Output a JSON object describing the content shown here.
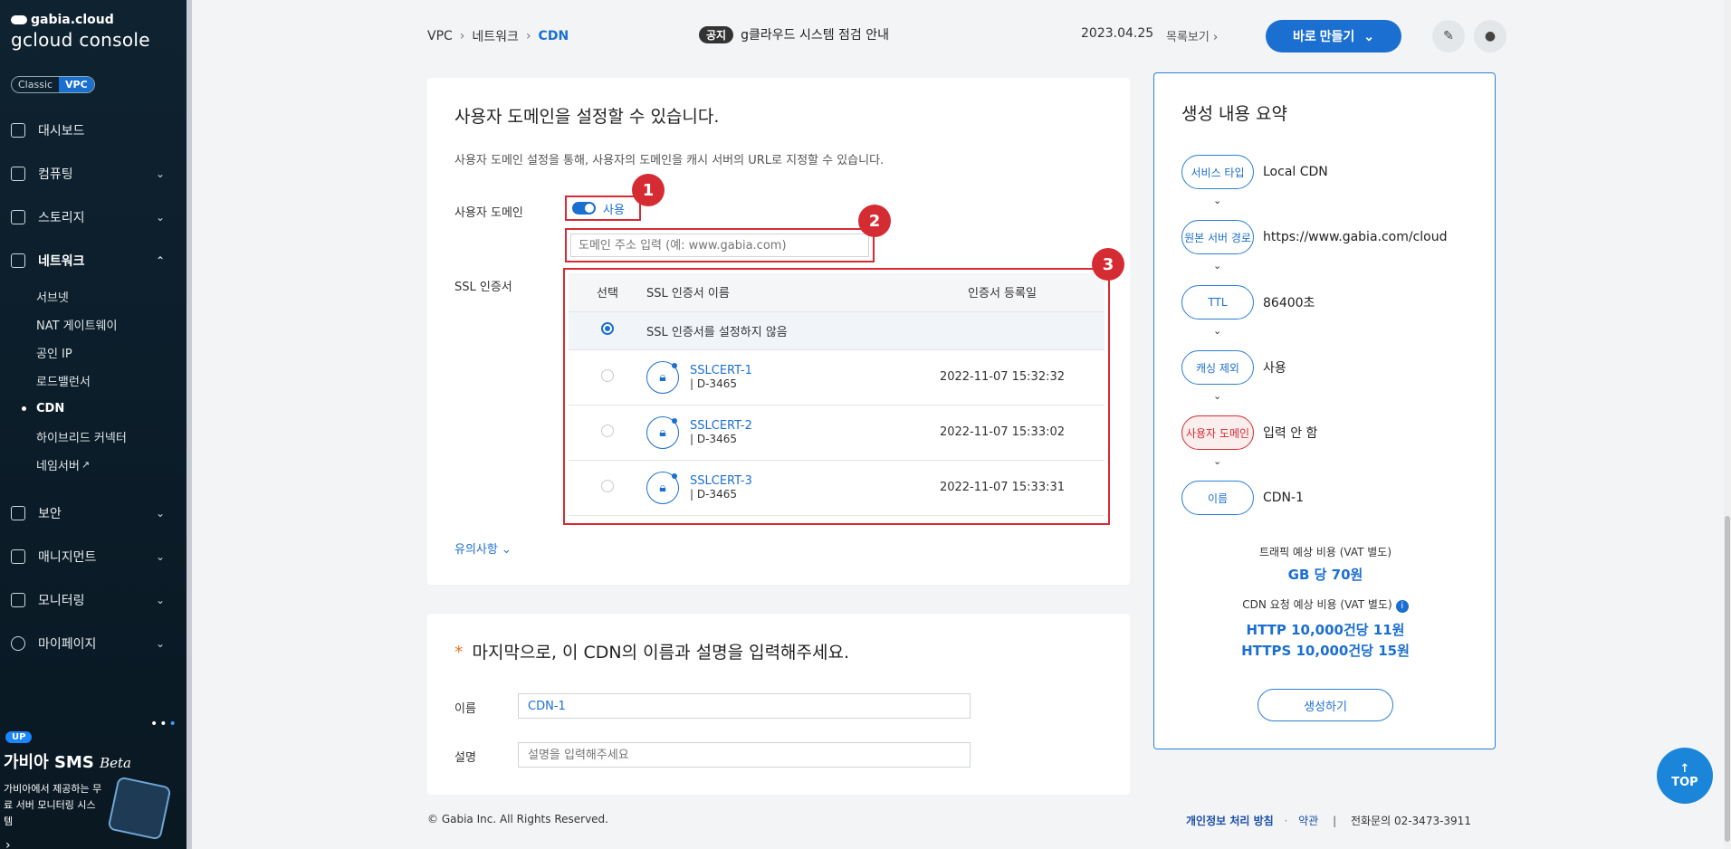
{
  "sidebar": {
    "brand_top": "gabia.cloud",
    "brand_bottom": "gcloud console",
    "switch": {
      "classic": "Classic",
      "vpc": "VPC"
    },
    "items": [
      {
        "label": "대시보드",
        "icon": "dashboard-icon"
      },
      {
        "label": "컴퓨팅",
        "icon": "chip-icon"
      },
      {
        "label": "스토리지",
        "icon": "storage-icon"
      },
      {
        "label": "네트워크",
        "icon": "network-icon"
      },
      {
        "label": "보안",
        "icon": "shield-icon"
      },
      {
        "label": "매니지먼트",
        "icon": "management-icon"
      },
      {
        "label": "모니터링",
        "icon": "monitor-icon"
      },
      {
        "label": "마이페이지",
        "icon": "user-icon"
      }
    ],
    "network_sub": [
      "서브넷",
      "NAT 게이트웨이",
      "공인 IP",
      "로드밸런서",
      "CDN",
      "하이브리드 커넥터",
      "네임서버"
    ],
    "promo": {
      "badge": "UP",
      "title": "가비아 SMS",
      "beta": "Beta",
      "desc": "가비아에서 제공하는 무료 서버 모니터링 시스템"
    }
  },
  "topbar": {
    "breadcrumb": [
      "VPC",
      "네트워크",
      "CDN"
    ],
    "notice_badge": "공지",
    "notice_text": "g클라우드 시스템 점검 안내",
    "date": "2023.04.25",
    "more": "목록보기",
    "make_button": "바로 만들기"
  },
  "domain_section": {
    "title": "사용자 도메인을 설정할 수 있습니다.",
    "desc": "사용자 도메인 설정을 통해, 사용자의 도메인을 캐시 서버의 URL로 지정할 수 있습니다.",
    "user_domain_label": "사용자 도메인",
    "toggle_label": "사용",
    "domain_placeholder": "도메인 주소 입력 (예: www.gabia.com)",
    "ssl_label": "SSL 인증서",
    "table_headers": [
      "선택",
      "SSL 인증서 이름",
      "인증서 등록일"
    ],
    "no_ssl": "SSL 인증서를 설정하지 않음",
    "certs": [
      {
        "name": "SSLCERT-1",
        "id": "|  D-3465",
        "date": "2022-11-07 15:32:32"
      },
      {
        "name": "SSLCERT-2",
        "id": "|  D-3465",
        "date": "2022-11-07 15:33:02"
      },
      {
        "name": "SSLCERT-3",
        "id": "|  D-3465",
        "date": "2022-11-07 15:33:31"
      }
    ],
    "markers": [
      "1",
      "2",
      "3"
    ],
    "notes_link": "유의사항"
  },
  "name_section": {
    "star": "*",
    "title": "마지막으로, 이 CDN의 이름과 설명을 입력해주세요.",
    "name_label": "이름",
    "name_value": "CDN-1",
    "desc_label": "설명",
    "desc_placeholder": "설명을 입력해주세요"
  },
  "summary": {
    "title": "생성 내용 요약",
    "rows": [
      {
        "key": "서비스 타입",
        "value": "Local CDN",
        "warn": false
      },
      {
        "key": "원본 서버 경로",
        "value": "https://www.gabia.com/cloud",
        "warn": false
      },
      {
        "key": "TTL",
        "value": "86400초",
        "warn": false
      },
      {
        "key": "캐싱 제외",
        "value": "사용",
        "warn": false
      },
      {
        "key": "사용자 도메인",
        "value": "입력 안 함",
        "warn": true
      },
      {
        "key": "이름",
        "value": "CDN-1",
        "warn": false
      }
    ],
    "traffic_label": "트래픽 예상 비용 (VAT 별도)",
    "traffic_value": "GB 당 70원",
    "request_label": "CDN 요청 예상 비용 (VAT 별도)",
    "http_value": "HTTP 10,000건당 11원",
    "https_value": "HTTPS 10,000건당 15원",
    "create_button": "생성하기"
  },
  "footer": {
    "copyright": "© Gabia Inc. All Rights Reserved.",
    "privacy": "개인정보 처리 방침",
    "terms": "약관",
    "contact": "전화문의  02-3473-3911"
  },
  "top_button": "TOP",
  "colors": {
    "accent": "#1b6fd1",
    "marker": "#d52b33"
  }
}
